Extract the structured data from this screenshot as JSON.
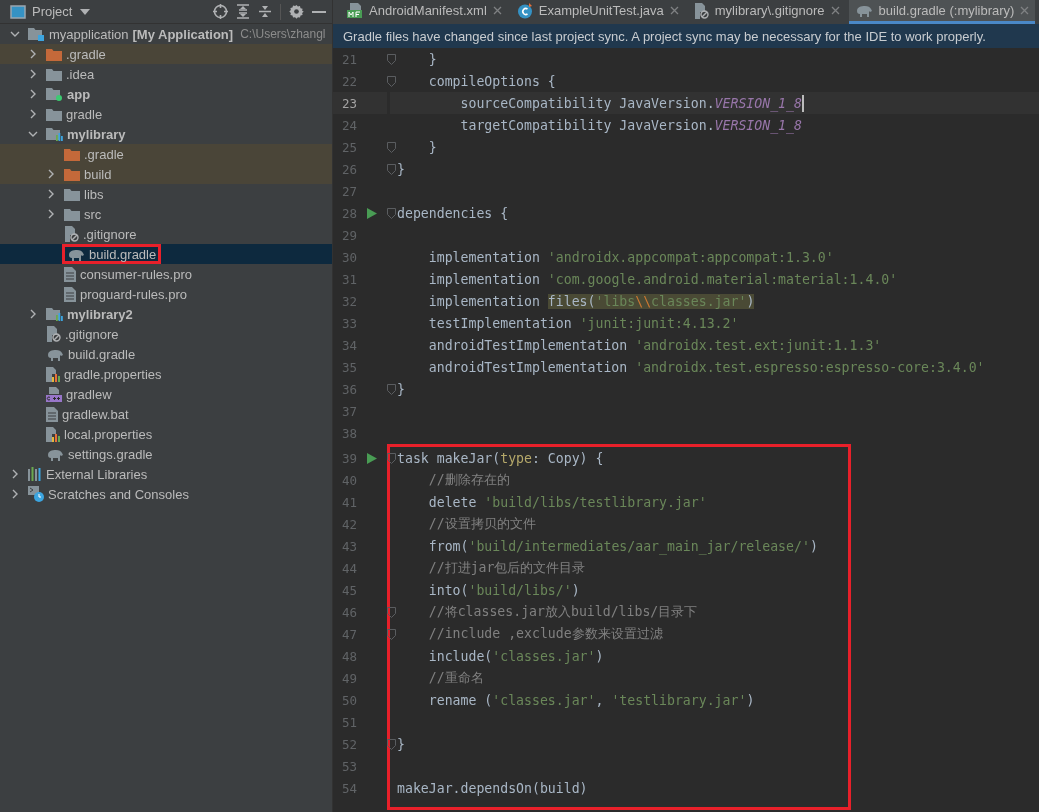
{
  "project_panel": {
    "title": "Project",
    "tree": [
      {
        "name": "myapplication",
        "suffix": "[My Application]",
        "path": "C:\\Users\\zhangl",
        "kind": "module-root",
        "expanded": true,
        "selected": false,
        "children": [
          {
            "name": ".gradle",
            "kind": "folder-excluded",
            "expanded": false,
            "selected": false
          },
          {
            "name": ".idea",
            "kind": "folder",
            "expanded": false,
            "selected": false
          },
          {
            "name": "app",
            "kind": "module-app",
            "bold": true,
            "expanded": false,
            "selected": false
          },
          {
            "name": "gradle",
            "kind": "folder",
            "expanded": false,
            "selected": false
          },
          {
            "name": "mylibrary",
            "kind": "module-lib",
            "bold": true,
            "expanded": true,
            "selected": false,
            "children": [
              {
                "name": ".gradle",
                "kind": "folder-excluded",
                "selected": false
              },
              {
                "name": "build",
                "kind": "folder-excluded",
                "expanded": false,
                "selected": false
              },
              {
                "name": "libs",
                "kind": "folder",
                "expanded": false,
                "selected": false
              },
              {
                "name": "src",
                "kind": "folder",
                "expanded": false,
                "selected": false
              },
              {
                "name": ".gitignore",
                "kind": "gitignore",
                "selected": false
              },
              {
                "name": "build.gradle",
                "kind": "gradle",
                "selected": true,
                "annotated": true
              },
              {
                "name": "consumer-rules.pro",
                "kind": "text",
                "selected": false
              },
              {
                "name": "proguard-rules.pro",
                "kind": "text",
                "selected": false
              }
            ]
          },
          {
            "name": "mylibrary2",
            "kind": "module-lib",
            "bold": true,
            "expanded": false,
            "selected": false
          },
          {
            "name": ".gitignore",
            "kind": "gitignore",
            "selected": false
          },
          {
            "name": "build.gradle",
            "kind": "gradle",
            "selected": false
          },
          {
            "name": "gradle.properties",
            "kind": "properties",
            "selected": false
          },
          {
            "name": "gradlew",
            "kind": "script",
            "selected": false
          },
          {
            "name": "gradlew.bat",
            "kind": "text",
            "selected": false
          },
          {
            "name": "local.properties",
            "kind": "properties",
            "selected": false
          },
          {
            "name": "settings.gradle",
            "kind": "gradle",
            "selected": false
          }
        ]
      },
      {
        "name": "External Libraries",
        "kind": "libraries",
        "expanded": false,
        "selected": false
      },
      {
        "name": "Scratches and Consoles",
        "kind": "scratches",
        "expanded": false,
        "selected": false
      }
    ]
  },
  "editor": {
    "tabs": [
      {
        "label": "AndroidManifest.xml",
        "kind": "manifest",
        "selected": false
      },
      {
        "label": "ExampleUnitTest.java",
        "kind": "java-test",
        "selected": false
      },
      {
        "label": "mylibrary\\.gitignore",
        "kind": "gitignore",
        "selected": false
      },
      {
        "label": "build.gradle (:mylibrary)",
        "kind": "gradle",
        "selected": true
      }
    ],
    "banner": "Gradle files have changed since last project sync. A project sync may be necessary for the IDE to work properly.",
    "sections": [
      {
        "boxed": false,
        "lines": [
          {
            "num": "21",
            "fold": true,
            "current": false,
            "tokens": [
              {
                "text": "    }",
                "kind": "plain"
              }
            ]
          },
          {
            "num": "22",
            "fold": true,
            "current": false,
            "tokens": [
              {
                "text": "    compileOptions {",
                "kind": "plain"
              }
            ]
          },
          {
            "num": "23",
            "current": true,
            "tokens": [
              {
                "text": "        sourceCompatibility JavaVersion.",
                "kind": "plain"
              },
              {
                "text": "VERSION_1_8",
                "kind": "constant"
              }
            ]
          },
          {
            "num": "24",
            "current": false,
            "tokens": [
              {
                "text": "        targetCompatibility JavaVersion.",
                "kind": "plain"
              },
              {
                "text": "VERSION_1_8",
                "kind": "constant"
              }
            ]
          },
          {
            "num": "25",
            "fold": true,
            "current": false,
            "tokens": [
              {
                "text": "    }",
                "kind": "plain"
              }
            ]
          },
          {
            "num": "26",
            "fold": true,
            "current": false,
            "tokens": [
              {
                "text": "}",
                "kind": "plain"
              }
            ]
          },
          {
            "num": "27",
            "current": false
          },
          {
            "num": "28",
            "run": true,
            "fold": true,
            "current": false,
            "tokens": [
              {
                "text": "dependencies {",
                "kind": "plain"
              }
            ]
          },
          {
            "num": "29",
            "current": false
          },
          {
            "num": "30",
            "current": false,
            "tokens": [
              {
                "text": "    implementation ",
                "kind": "plain"
              },
              {
                "text": "'androidx.appcompat:appcompat:1.3.0'",
                "kind": "string"
              }
            ]
          },
          {
            "num": "31",
            "current": false,
            "tokens": [
              {
                "text": "    implementation ",
                "kind": "plain"
              },
              {
                "text": "'com.google.android.material:material:1.4.0'",
                "kind": "string"
              }
            ]
          },
          {
            "num": "32",
            "current": false,
            "tokens": [
              {
                "text": "    implementation ",
                "kind": "plain"
              },
              {
                "text": "files(",
                "kind": "plain",
                "highlighted": true
              },
              {
                "text": "'libs",
                "kind": "string",
                "highlighted": true
              },
              {
                "text": "\\\\",
                "kind": "escape",
                "highlighted": true
              },
              {
                "text": "classes.jar'",
                "kind": "string",
                "highlighted": true
              },
              {
                "text": ")",
                "kind": "plain",
                "highlighted": true
              }
            ]
          },
          {
            "num": "33",
            "current": false,
            "tokens": [
              {
                "text": "    testImplementation ",
                "kind": "plain"
              },
              {
                "text": "'junit:junit:4.13.2'",
                "kind": "string"
              }
            ]
          },
          {
            "num": "34",
            "current": false,
            "tokens": [
              {
                "text": "    androidTestImplementation ",
                "kind": "plain"
              },
              {
                "text": "'androidx.test.ext:junit:1.1.3'",
                "kind": "string"
              }
            ]
          },
          {
            "num": "35",
            "current": false,
            "tokens": [
              {
                "text": "    androidTestImplementation ",
                "kind": "plain"
              },
              {
                "text": "'androidx.test.espresso:espresso-core:3.4.0'",
                "kind": "string"
              }
            ]
          },
          {
            "num": "36",
            "fold": true,
            "current": false,
            "tokens": [
              {
                "text": "}",
                "kind": "plain"
              }
            ]
          },
          {
            "num": "37",
            "current": false
          },
          {
            "num": "38",
            "current": false
          }
        ]
      },
      {
        "boxed": true,
        "lines": [
          {
            "num": "39",
            "run": true,
            "fold": true,
            "current": false,
            "tokens": [
              {
                "text": "task makeJar(",
                "kind": "plain"
              },
              {
                "text": "type",
                "kind": "param"
              },
              {
                "text": ": Copy) {",
                "kind": "plain"
              }
            ]
          },
          {
            "num": "40",
            "current": false,
            "tokens": [
              {
                "text": "    //删除存在的",
                "kind": "comment"
              }
            ]
          },
          {
            "num": "41",
            "current": false,
            "tokens": [
              {
                "text": "    delete ",
                "kind": "plain"
              },
              {
                "text": "'build/libs/testlibrary.jar'",
                "kind": "string"
              }
            ]
          },
          {
            "num": "42",
            "current": false,
            "tokens": [
              {
                "text": "    //设置拷贝的文件",
                "kind": "comment"
              }
            ]
          },
          {
            "num": "43",
            "current": false,
            "tokens": [
              {
                "text": "    from(",
                "kind": "plain"
              },
              {
                "text": "'build/intermediates/aar_main_jar/release/'",
                "kind": "string"
              },
              {
                "text": ")",
                "kind": "plain"
              }
            ]
          },
          {
            "num": "44",
            "current": false,
            "tokens": [
              {
                "text": "    //打进jar包后的文件目录",
                "kind": "comment"
              }
            ]
          },
          {
            "num": "45",
            "current": false,
            "tokens": [
              {
                "text": "    into(",
                "kind": "plain"
              },
              {
                "text": "'build/libs/'",
                "kind": "string"
              },
              {
                "text": ")",
                "kind": "plain"
              }
            ]
          },
          {
            "num": "46",
            "fold": true,
            "current": false,
            "tokens": [
              {
                "text": "    //将classes.jar放入build/libs/目录下",
                "kind": "comment"
              }
            ]
          },
          {
            "num": "47",
            "fold": true,
            "current": false,
            "tokens": [
              {
                "text": "    //include ,exclude参数来设置过滤",
                "kind": "comment"
              }
            ]
          },
          {
            "num": "48",
            "current": false,
            "tokens": [
              {
                "text": "    include(",
                "kind": "plain"
              },
              {
                "text": "'classes.jar'",
                "kind": "string"
              },
              {
                "text": ")",
                "kind": "plain"
              }
            ]
          },
          {
            "num": "49",
            "current": false,
            "tokens": [
              {
                "text": "    //重命名",
                "kind": "comment"
              }
            ]
          },
          {
            "num": "50",
            "current": false,
            "tokens": [
              {
                "text": "    rename (",
                "kind": "plain"
              },
              {
                "text": "'classes.jar'",
                "kind": "string"
              },
              {
                "text": ", ",
                "kind": "plain"
              },
              {
                "text": "'testlibrary.jar'",
                "kind": "string"
              },
              {
                "text": ")",
                "kind": "plain"
              }
            ]
          },
          {
            "num": "51",
            "current": false
          },
          {
            "num": "52",
            "fold": true,
            "current": false,
            "tokens": [
              {
                "text": "}",
                "kind": "plain"
              }
            ]
          },
          {
            "num": "53",
            "current": false
          },
          {
            "num": "54",
            "current": false,
            "tokens": [
              {
                "text": "makeJar.dependsOn(build)",
                "kind": "plain"
              }
            ]
          }
        ]
      }
    ]
  }
}
